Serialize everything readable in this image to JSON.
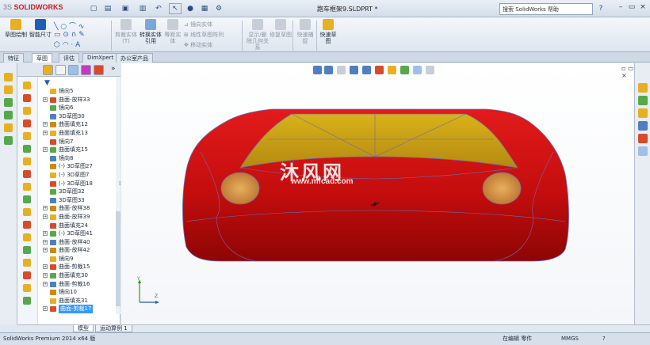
{
  "titlebar": {
    "app_logo": "SOLIDWORKS",
    "app_logo_prefix": "3S",
    "document_title": "跑车框架9.SLDPRT *",
    "search_placeholder": "搜索 SolidWorks 帮助",
    "quick_access_icons": [
      "new-icon",
      "open-icon",
      "save-icon",
      "print-icon",
      "undo-icon",
      "select-icon",
      "rebuild-icon",
      "options-icon"
    ]
  },
  "ribbon": {
    "buttons": [
      {
        "label": "草图绘制",
        "state": "normal"
      },
      {
        "label": "智能尺寸",
        "state": "normal"
      },
      {
        "label": "剪裁实体(T)",
        "state": "dim"
      },
      {
        "label": "转换实体引用",
        "state": "normal"
      },
      {
        "label": "等距实体",
        "state": "dim"
      },
      {
        "label": "显示/删除几何关系",
        "state": "dim"
      },
      {
        "label": "修复草图",
        "state": "dim"
      },
      {
        "label": "快速捕捉",
        "state": "dim"
      },
      {
        "label": "快速草图",
        "state": "normal"
      }
    ],
    "small_commands": [
      "镜向实体",
      "线性草图阵列",
      "移动实体"
    ]
  },
  "tabs": [
    {
      "label": "特征",
      "active": false
    },
    {
      "label": "草图",
      "active": true
    },
    {
      "label": "评估",
      "active": false
    },
    {
      "label": "DimXpert",
      "active": false
    },
    {
      "label": "办公室产品",
      "active": false
    }
  ],
  "tree": {
    "items": [
      {
        "label": "镜向5",
        "exp": false
      },
      {
        "label": "曲面-放样33",
        "exp": true
      },
      {
        "label": "镜向6",
        "exp": false
      },
      {
        "label": "3D草图30",
        "exp": false
      },
      {
        "label": "曲面填充12",
        "exp": true
      },
      {
        "label": "曲面填充13",
        "exp": true
      },
      {
        "label": "镜向7",
        "exp": false
      },
      {
        "label": "曲面填充15",
        "exp": true
      },
      {
        "label": "镜向8",
        "exp": false
      },
      {
        "label": "(-) 3D草图27",
        "exp": false
      },
      {
        "label": "(-) 3D草图7",
        "exp": false
      },
      {
        "label": "(-) 3D草图18",
        "exp": false
      },
      {
        "label": "3D草图32",
        "exp": false
      },
      {
        "label": "3D草图33",
        "exp": false
      },
      {
        "label": "曲面-放样38",
        "exp": true
      },
      {
        "label": "曲面-放样39",
        "exp": true
      },
      {
        "label": "曲面填充24",
        "exp": false
      },
      {
        "label": "(-) 3D草图41",
        "exp": true
      },
      {
        "label": "曲面-放样40",
        "exp": true
      },
      {
        "label": "曲面-放样42",
        "exp": true
      },
      {
        "label": "镜向9",
        "exp": false
      },
      {
        "label": "曲面-剪裁15",
        "exp": true
      },
      {
        "label": "曲面填充30",
        "exp": true
      },
      {
        "label": "曲面-剪裁16",
        "exp": true
      },
      {
        "label": "镜向10",
        "exp": false
      },
      {
        "label": "曲面填充31",
        "exp": false
      },
      {
        "label": "曲面-剪裁17",
        "exp": true,
        "selected": true
      }
    ]
  },
  "bottom_tabs": [
    {
      "label": "模型",
      "active": true
    },
    {
      "label": "运动算例 1",
      "active": false
    }
  ],
  "status": {
    "app_version": "SolidWorks Premium 2014 x64 版",
    "mode": "在编辑 零件",
    "units": "MMGS"
  },
  "watermark": {
    "text": "沐风网",
    "url": "www.mfcad.com"
  },
  "triad": {
    "y_label": "Y",
    "z_label": "Z"
  },
  "colors": {
    "car_body": "#d01010",
    "windshield": "#c9a317",
    "accent_blue": "#1d5fb8"
  }
}
